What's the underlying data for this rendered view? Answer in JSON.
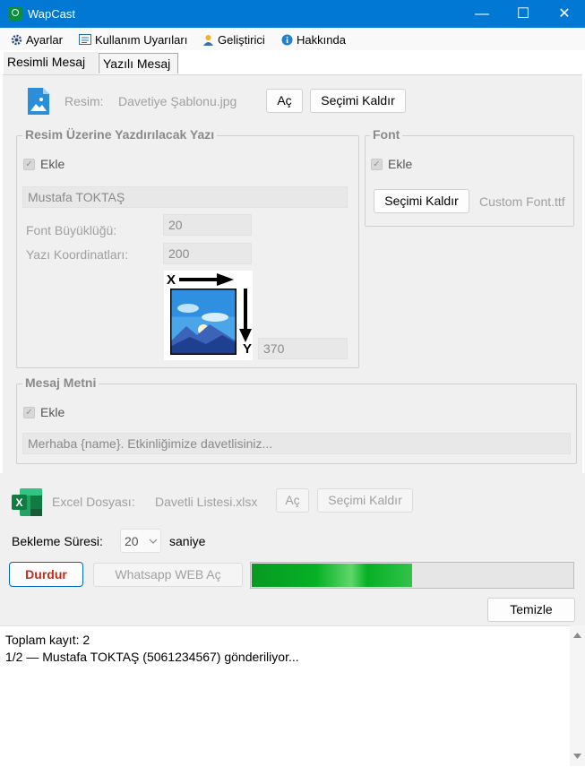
{
  "window": {
    "title": "WapCast",
    "minimize": "—",
    "maximize": "☐",
    "close": "✕"
  },
  "menu": {
    "items": [
      {
        "label": "Ayarlar",
        "icon": "gear-icon"
      },
      {
        "label": "Kullanım Uyarıları",
        "icon": "list-icon"
      },
      {
        "label": "Geliştirici",
        "icon": "person-icon"
      },
      {
        "label": "Hakkında",
        "icon": "info-icon"
      }
    ]
  },
  "tabs": [
    {
      "label": "Resimli Mesaj",
      "active": true
    },
    {
      "label": "Yazılı Mesaj",
      "active": false
    }
  ],
  "image_row": {
    "label": "Resim:",
    "filename": "Davetiye Şablonu.jpg",
    "open_label": "Aç",
    "clear_label": "Seçimi Kaldır"
  },
  "text_group": {
    "legend": "Resim Üzerine Yazdırılacak Yazı",
    "add_label": "Ekle",
    "text_value": "Mustafa TOKTAŞ",
    "font_size_label": "Font Büyüklüğü:",
    "font_size_value": "20",
    "coords_label": "Yazı Koordinatları:",
    "x_value": "200",
    "y_value": "370",
    "x_axis": "X",
    "y_axis": "Y"
  },
  "font_group": {
    "legend": "Font",
    "add_label": "Ekle",
    "clear_label": "Seçimi Kaldır",
    "font_name": "Custom Font.ttf"
  },
  "message_group": {
    "legend": "Mesaj Metni",
    "add_label": "Ekle",
    "text_value": "Merhaba {name}. Etkinliğimize davetlisiniz..."
  },
  "excel_row": {
    "label": "Excel Dosyası:",
    "filename": "Davetli Listesi.xlsx",
    "open_label": "Aç",
    "clear_label": "Seçimi Kaldır"
  },
  "wait_row": {
    "label": "Bekleme Süresi:",
    "value": "20",
    "unit": "saniye"
  },
  "actions": {
    "stop_label": "Durdur",
    "whatsapp_label": "Whatsapp WEB Aç",
    "clear_label": "Temizle",
    "progress": 0.5
  },
  "colors": {
    "accent": "#0078d4",
    "stop": "#c42b1c",
    "progress": "#06b025"
  },
  "log": {
    "lines": [
      "Toplam kayıt: 2",
      "1/2 — Mustafa TOKTAŞ (5061234567) gönderiliyor..."
    ]
  }
}
